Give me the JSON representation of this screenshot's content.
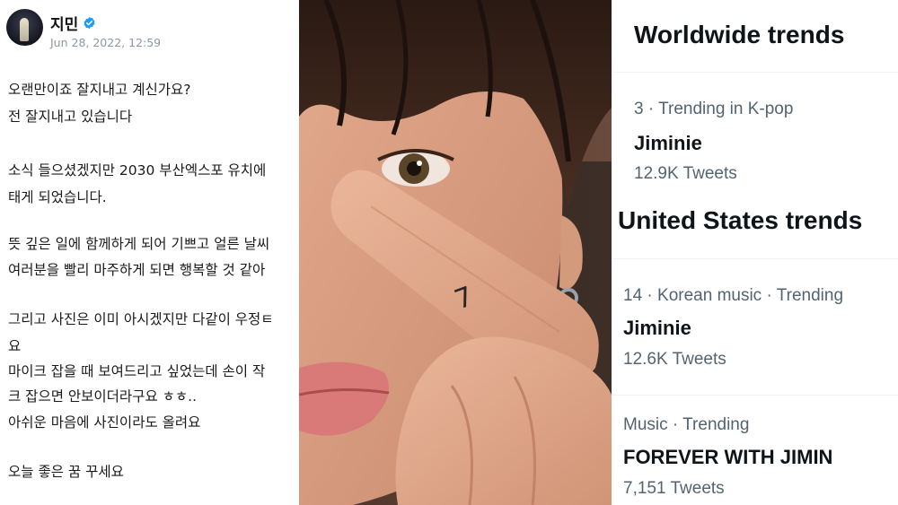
{
  "post": {
    "author": "지민",
    "timestamp": "Jun 28, 2022, 12:59",
    "lines": [
      "오랜만이죠 잘지내고 계신가요?",
      "전 잘지내고 있습니다",
      "소식 들으셨겠지만 2030 부산엑스포 유치에",
      "태게 되었습니다.",
      "뜻 깊은 일에 함께하게 되어 기쁘고 얼른 날씨",
      "여러분을 빨리 마주하게 되면 행복할 것 같아",
      "그리고 사진은 이미 아시겠지만 다같이 우정ㅌ",
      "요",
      "마이크 잡을 때 보여드리고 싶었는데 손이 작",
      "크 잡으면 안보이더라구요 ㅎㅎ..",
      "아쉬운 마음에 사진이라도 올려요",
      "오늘 좋은 꿈 꾸세요"
    ]
  },
  "photo": {
    "finger_tattoo": "7"
  },
  "trends": {
    "worldwide_heading": "Worldwide trends",
    "us_heading": "United States trends",
    "items": [
      {
        "meta": "3 · Trending in K-pop",
        "name": "Jiminie",
        "count": "12.9K Tweets"
      },
      {
        "meta": "14 · Korean music · Trending",
        "name": "Jiminie",
        "count": "12.6K Tweets"
      },
      {
        "meta": "Music · Trending",
        "name": "FOREVER WITH JIMIN",
        "count": "7,151 Tweets"
      }
    ]
  },
  "colors": {
    "verified_blue": "#1d9bf0",
    "muted_text": "#536471",
    "primary_text": "#0f1419"
  }
}
